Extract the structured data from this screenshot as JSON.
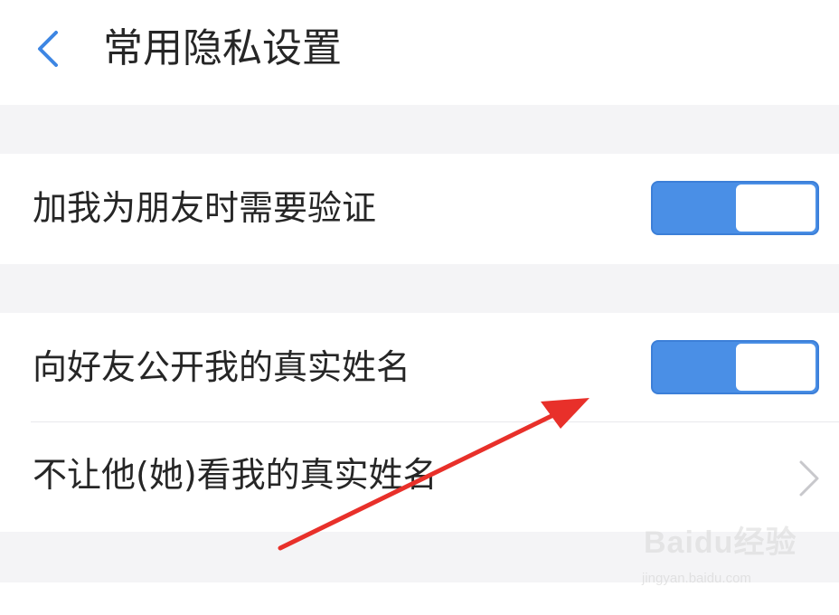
{
  "header": {
    "title": "常用隐私设置",
    "back_icon": "chevron-left-icon"
  },
  "settings": {
    "friend_verification": {
      "label": "加我为朋友时需要验证",
      "enabled": true
    },
    "show_real_name": {
      "label": "向好友公开我的真实姓名",
      "enabled": true
    },
    "hide_real_name_from": {
      "label": "不让他(她)看我的真实姓名",
      "icon": "chevron-right-icon"
    }
  },
  "colors": {
    "accent": "#4a8fe6",
    "background": "#f4f4f6",
    "surface": "#ffffff",
    "annotation_arrow": "#e8302a"
  },
  "watermark": {
    "brand": "Baidu经验",
    "url": "jingyan.baidu.com"
  }
}
